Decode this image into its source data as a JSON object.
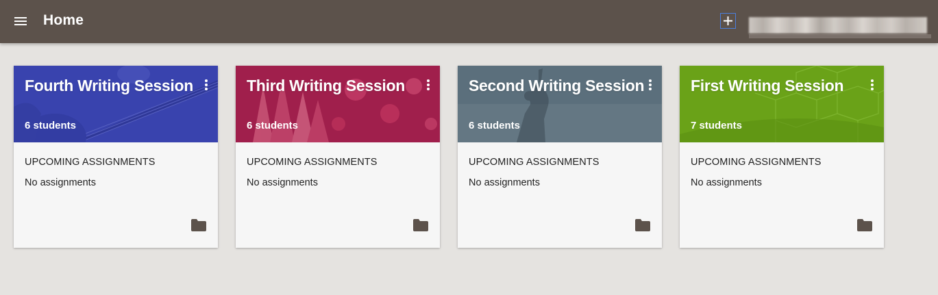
{
  "header": {
    "title": "Home",
    "menu_icon": "hamburger-menu-icon",
    "add_icon": "plus-icon",
    "background": "#5c524b"
  },
  "classes": [
    {
      "title": "Fourth Writing Session",
      "students": "6 students",
      "color": "#3f4ab8",
      "theme": "guitar",
      "upcoming_heading": "UPCOMING ASSIGNMENTS",
      "upcoming_value": "No assignments"
    },
    {
      "title": "Third Writing Session",
      "students": "6 students",
      "color": "#a01f4c",
      "theme": "pencils",
      "upcoming_heading": "UPCOMING ASSIGNMENTS",
      "upcoming_value": "No assignments"
    },
    {
      "title": "Second Writing Session",
      "students": "6 students",
      "color": "#5b6f7c",
      "theme": "silhouette",
      "upcoming_heading": "UPCOMING ASSIGNMENTS",
      "upcoming_value": "No assignments"
    },
    {
      "title": "First Writing Session",
      "students": "7 students",
      "color": "#6aa218",
      "theme": "soccer-net",
      "upcoming_heading": "UPCOMING ASSIGNMENTS",
      "upcoming_value": "No assignments"
    }
  ],
  "icons": {
    "more": "more-vert-icon",
    "folder": "folder-icon"
  },
  "colors": {
    "page_background": "#e5e3e0",
    "card_body": "#f6f6f6",
    "folder": "#5c524b"
  }
}
